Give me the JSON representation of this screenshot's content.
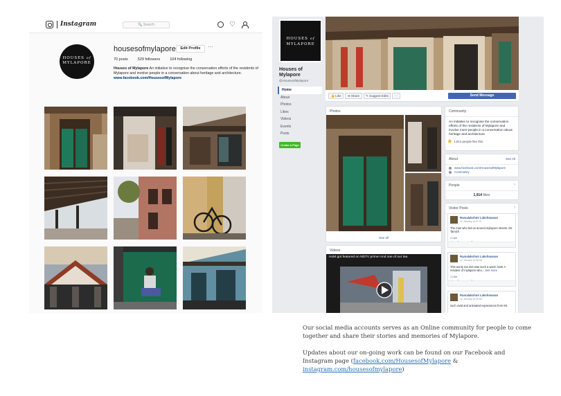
{
  "instagram": {
    "wordmark": "Instagram",
    "search_placeholder": "Search",
    "username": "housesofmylapore",
    "edit_profile_label": "Edit Profile",
    "more_label": "···",
    "stats": {
      "posts": "70 posts",
      "followers": "529 followers",
      "following": "104 following"
    },
    "avatar_text_line1": "HOUSES",
    "avatar_text_of": "of",
    "avatar_text_line2": "MYLAPORE",
    "bio_name": "Houses of Mylapore",
    "bio_text": "An initiative to recognise the conservation efforts of the residents of Mylapore and involve people in a conversation about heritage and architecture.",
    "bio_link": "www.facebook.com/HousesofMylapore"
  },
  "facebook": {
    "avatar_text_line1": "HOUSES",
    "avatar_text_of": "of",
    "avatar_text_line2": "MYLAPORE",
    "page_name": "Houses of Mylapore",
    "handle": "@HousesofMylapore",
    "nav": [
      "Home",
      "About",
      "Photos",
      "Likes",
      "Videos",
      "Events",
      "Posts"
    ],
    "create_page_label": "Create a Page",
    "actions": {
      "like": "Like",
      "share": "Share",
      "suggest": "Suggest Edits",
      "dots": "···",
      "send": "Send Message"
    },
    "photos_title": "Photos",
    "photos_see_all": "See all",
    "videos_title": "Videos",
    "video_caption": "HoM got featured on NDTV prime! And one of our tea",
    "community": {
      "title": "Community",
      "description": "An initiative to recognise the conservation efforts of the residents of Mylapore and involve more people in a conversation about heritage and architecture.",
      "likes": "1,914 people like this"
    },
    "about": {
      "title": "About",
      "see_all": "See All",
      "url": "www.facebook.com/HousesofMylapore",
      "category": "Community"
    },
    "people": {
      "title": "People",
      "count": "1,914",
      "count_suffix": "likes"
    },
    "wall": {
      "title": "Visitor Posts",
      "posts": [
        {
          "author": "Ramalakshmi Lakshmanan",
          "date": "12 January at 07:37",
          "text": "The man who led us around mylapore streets. Mr. Tamizh",
          "likes": "1 Like",
          "actions": "Like  Comment  Share"
        },
        {
          "author": "Ramalakshmi Lakshmanan",
          "date": "12 January at 06:56",
          "text": "This aunty ma met was such a warm host! A resident of mylapore who...",
          "more": "See more",
          "likes": "1 Like",
          "actions": "Like  Comment  Share"
        },
        {
          "author": "Ramalakshmi Lakshmanan",
          "date": "12 January at 06:56",
          "text": "such vivid and animated expressions from Mr."
        }
      ]
    }
  },
  "caption": {
    "paragraph1": "Our social media accounts serves as an Online community for people to come together and share their stories and memories of Mylapore.",
    "paragraph2_prefix": "Updates about our on-going work can be found on our Facebook and Instagram page (",
    "facebook_link": "facebook.com/HousesofMylapore",
    "separator": " & ",
    "instagram_link": "instagram.com/housesofmylapore",
    "paragraph2_suffix": ")"
  }
}
